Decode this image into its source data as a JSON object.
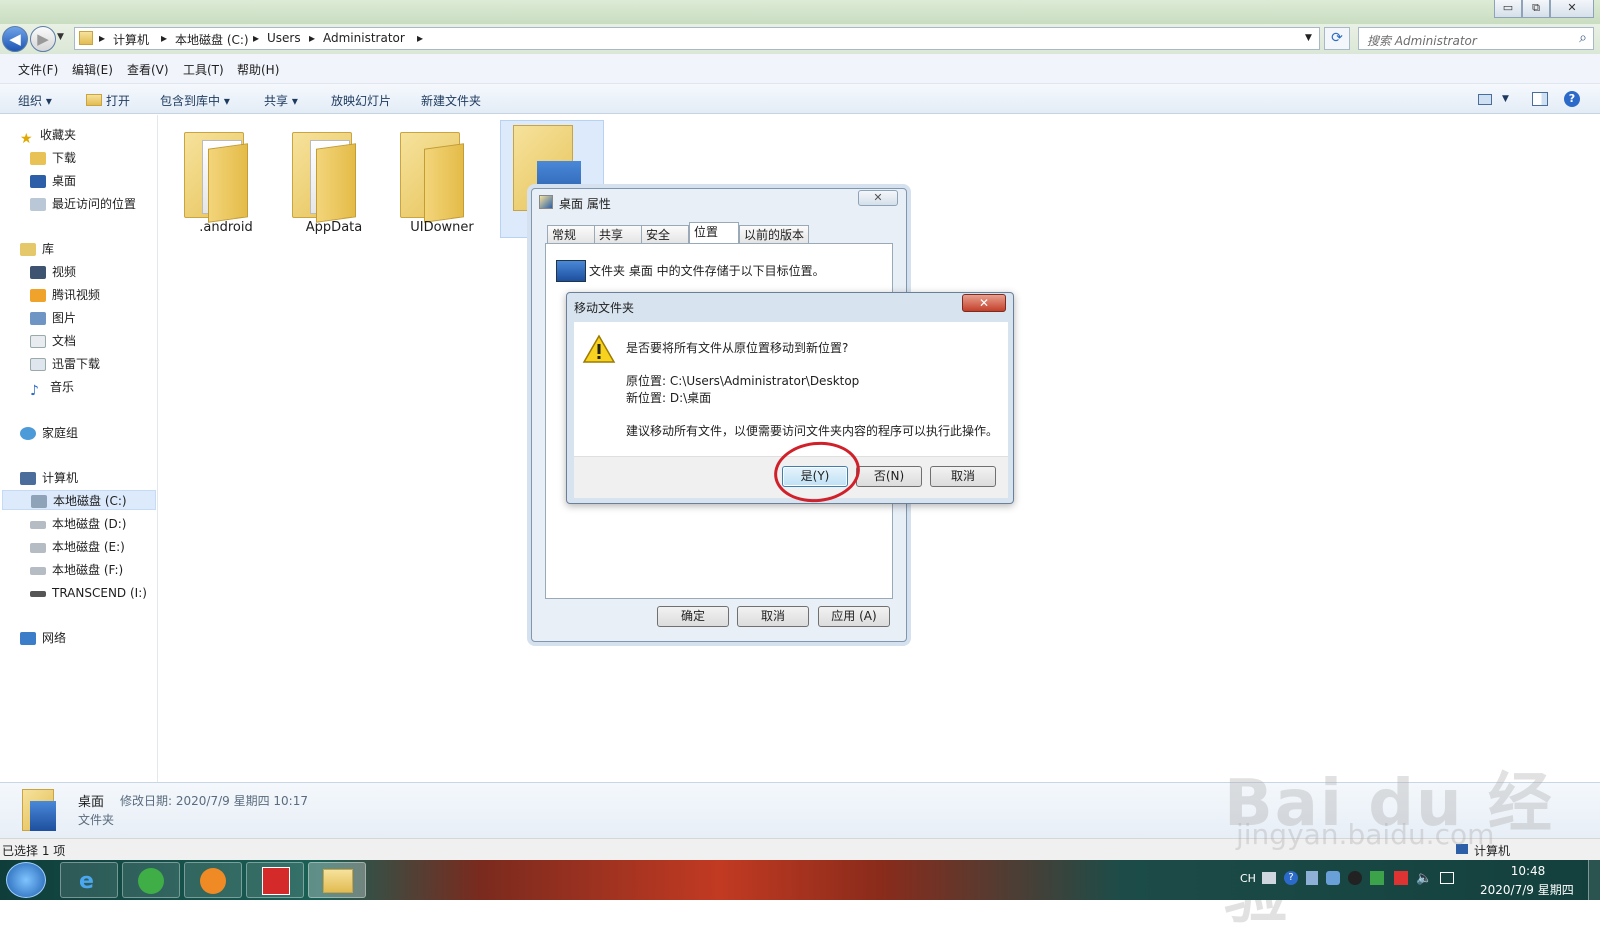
{
  "window": {
    "minimize": "▭",
    "restore": "⧉",
    "close": "✕"
  },
  "address": {
    "segments": [
      "计算机",
      "本地磁盘 (C:)",
      "Users",
      "Administrator"
    ],
    "search_placeholder": "搜索 Administrator"
  },
  "menu": [
    "文件(F)",
    "编辑(E)",
    "查看(V)",
    "工具(T)",
    "帮助(H)"
  ],
  "toolbar": [
    "组织 ▾",
    "打开",
    "包含到库中 ▾",
    "共享 ▾",
    "放映幻灯片",
    "新建文件夹"
  ],
  "nav": {
    "favorites": {
      "label": "收藏夹",
      "items": [
        "下载",
        "桌面",
        "最近访问的位置"
      ]
    },
    "libraries": {
      "label": "库",
      "items": [
        "视频",
        "腾讯视频",
        "图片",
        "文档",
        "迅雷下载",
        "音乐"
      ]
    },
    "homegroup": "家庭组",
    "computer": {
      "label": "计算机",
      "items": [
        "本地磁盘 (C:)",
        "本地磁盘 (D:)",
        "本地磁盘 (E:)",
        "本地磁盘 (F:)",
        "TRANSCEND (I:)"
      ]
    },
    "network": "网络"
  },
  "folders": [
    ".android",
    "AppData",
    "UIDowner"
  ],
  "details": {
    "name": "桌面",
    "modified": "修改日期: 2020/7/9 星期四 10:17",
    "type": "文件夹"
  },
  "status": {
    "selected": "已选择 1 项",
    "right": "计算机"
  },
  "properties_dialog": {
    "title": "桌面 属性",
    "tabs": [
      "常规",
      "共享",
      "安全",
      "位置",
      "以前的版本"
    ],
    "description": "文件夹 桌面 中的文件存储于以下目标位置。",
    "ok": "确定",
    "cancel": "取消",
    "apply": "应用 (A)"
  },
  "move_dialog": {
    "title": "移动文件夹",
    "question": "是否要将所有文件从原位置移动到新位置?",
    "original": "原位置: C:\\Users\\Administrator\\Desktop",
    "new": "新位置: D:\\桌面",
    "advice": "建议移动所有文件，以便需要访问文件夹内容的程序可以执行此操作。",
    "yes": "是(Y)",
    "no": "否(N)",
    "cancel": "取消"
  },
  "tray": {
    "lang": "CH",
    "time": "10:48",
    "date": "2020/7/9 星期四"
  },
  "watermark": {
    "brand": "Bai du 经验",
    "url": "jingyan.baidu.com"
  },
  "colors": {
    "highlight_circle": "#d0202a",
    "selection": "#dceafc"
  }
}
